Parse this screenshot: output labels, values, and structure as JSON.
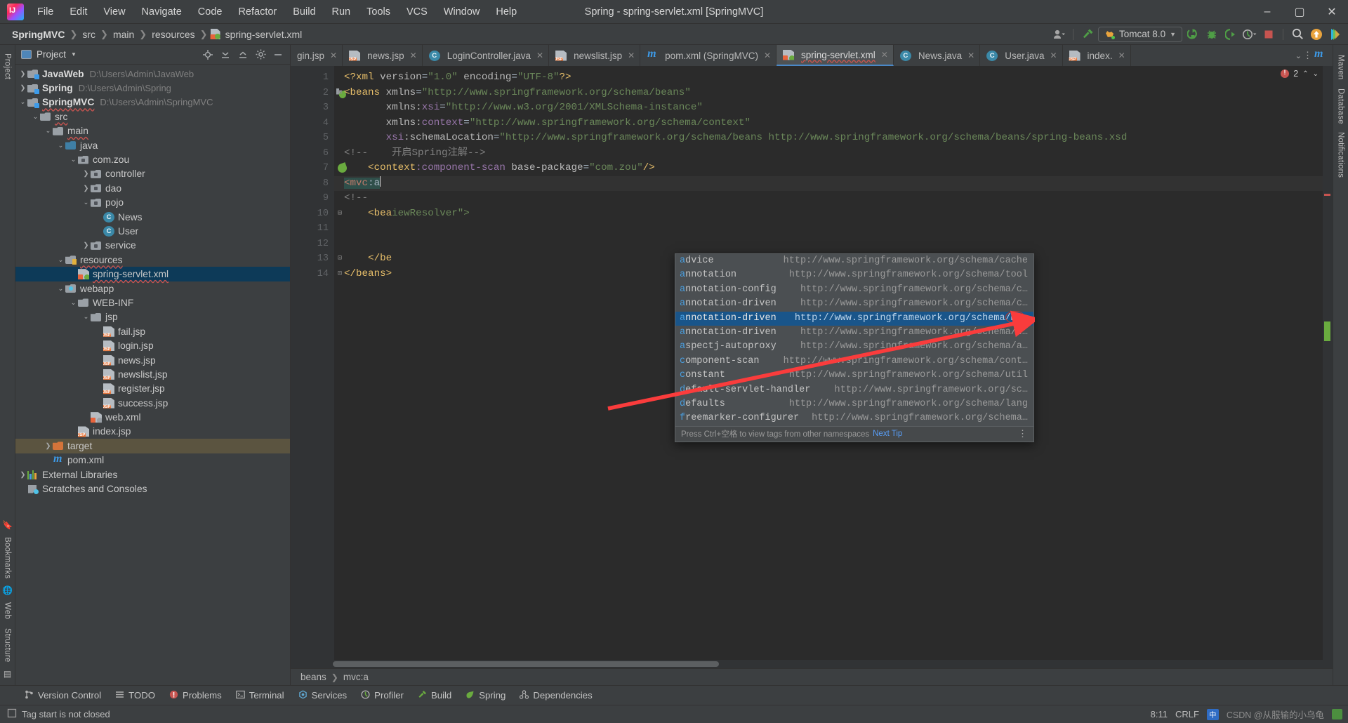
{
  "window": {
    "title": "Spring - spring-servlet.xml [SpringMVC]",
    "minimize": "–",
    "maximize": "▢",
    "close": "✕"
  },
  "menu": [
    "File",
    "Edit",
    "View",
    "Navigate",
    "Code",
    "Refactor",
    "Build",
    "Run",
    "Tools",
    "VCS",
    "Window",
    "Help"
  ],
  "breadcrumb": {
    "project": "SpringMVC",
    "items": [
      "src",
      "main",
      "resources"
    ],
    "file": "spring-servlet.xml"
  },
  "toolbar": {
    "run_config": "Tomcat 8.0",
    "icons": [
      "user-avatar-icon",
      "hammer-build-icon",
      "run-icon",
      "debug-icon",
      "run-with-coverage-icon",
      "profiler-icon",
      "stop-icon",
      "search-everywhere-icon",
      "update-project-icon",
      "idea-feature-icon"
    ]
  },
  "project_panel": {
    "title": "Project",
    "header_icons": [
      "locate-icon",
      "expand-all-icon",
      "collapse-all-icon",
      "settings-gear-icon",
      "hide-icon"
    ],
    "tree": [
      {
        "label": "JavaWeb",
        "path": "D:\\Users\\Admin\\JavaWeb",
        "indent": 0,
        "arrow": "collapsed",
        "icon": "module",
        "bold": true
      },
      {
        "label": "Spring",
        "path": "D:\\Users\\Admin\\Spring",
        "indent": 0,
        "arrow": "collapsed",
        "icon": "module",
        "bold": true
      },
      {
        "label": "SpringMVC",
        "path": "D:\\Users\\Admin\\SpringMVC",
        "indent": 0,
        "arrow": "expanded",
        "icon": "module",
        "bold": true,
        "wavy": true
      },
      {
        "label": "src",
        "path": "",
        "indent": 1,
        "arrow": "expanded",
        "icon": "folder",
        "wavy": true
      },
      {
        "label": "main",
        "path": "",
        "indent": 2,
        "arrow": "expanded",
        "icon": "folder",
        "wavy": true
      },
      {
        "label": "java",
        "path": "",
        "indent": 3,
        "arrow": "expanded",
        "icon": "sourceroot"
      },
      {
        "label": "com.zou",
        "path": "",
        "indent": 4,
        "arrow": "expanded",
        "icon": "package"
      },
      {
        "label": "controller",
        "path": "",
        "indent": 5,
        "arrow": "collapsed",
        "icon": "package"
      },
      {
        "label": "dao",
        "path": "",
        "indent": 5,
        "arrow": "collapsed",
        "icon": "package"
      },
      {
        "label": "pojo",
        "path": "",
        "indent": 5,
        "arrow": "expanded",
        "icon": "package"
      },
      {
        "label": "News",
        "path": "",
        "indent": 6,
        "arrow": "none",
        "icon": "class"
      },
      {
        "label": "User",
        "path": "",
        "indent": 6,
        "arrow": "none",
        "icon": "class"
      },
      {
        "label": "service",
        "path": "",
        "indent": 5,
        "arrow": "collapsed",
        "icon": "package"
      },
      {
        "label": "resources",
        "path": "",
        "indent": 3,
        "arrow": "expanded",
        "icon": "resources",
        "wavy": true
      },
      {
        "label": "spring-servlet.xml",
        "path": "",
        "indent": 4,
        "arrow": "none",
        "icon": "spring-xml",
        "selected": true,
        "wavy": true
      },
      {
        "label": "webapp",
        "path": "",
        "indent": 3,
        "arrow": "expanded",
        "icon": "webroot"
      },
      {
        "label": "WEB-INF",
        "path": "",
        "indent": 4,
        "arrow": "expanded",
        "icon": "folder"
      },
      {
        "label": "jsp",
        "path": "",
        "indent": 5,
        "arrow": "expanded",
        "icon": "folder"
      },
      {
        "label": "fail.jsp",
        "path": "",
        "indent": 6,
        "arrow": "none",
        "icon": "jsp"
      },
      {
        "label": "login.jsp",
        "path": "",
        "indent": 6,
        "arrow": "none",
        "icon": "jsp"
      },
      {
        "label": "news.jsp",
        "path": "",
        "indent": 6,
        "arrow": "none",
        "icon": "jsp"
      },
      {
        "label": "newslist.jsp",
        "path": "",
        "indent": 6,
        "arrow": "none",
        "icon": "jsp"
      },
      {
        "label": "register.jsp",
        "path": "",
        "indent": 6,
        "arrow": "none",
        "icon": "jsp"
      },
      {
        "label": "success.jsp",
        "path": "",
        "indent": 6,
        "arrow": "none",
        "icon": "jsp"
      },
      {
        "label": "web.xml",
        "path": "",
        "indent": 5,
        "arrow": "none",
        "icon": "web-xml"
      },
      {
        "label": "index.jsp",
        "path": "",
        "indent": 4,
        "arrow": "none",
        "icon": "jsp"
      },
      {
        "label": "target",
        "path": "",
        "indent": 2,
        "arrow": "collapsed",
        "icon": "target",
        "highlight": true
      },
      {
        "label": "pom.xml",
        "path": "",
        "indent": 2,
        "arrow": "none",
        "icon": "maven"
      },
      {
        "label": "External Libraries",
        "path": "",
        "indent": 0,
        "arrow": "collapsed",
        "icon": "library"
      },
      {
        "label": "Scratches and Consoles",
        "path": "",
        "indent": 0,
        "arrow": "none",
        "icon": "scratch"
      }
    ]
  },
  "left_rail": {
    "top": "Project",
    "bottom": [
      "Bookmarks",
      "Web",
      "Structure"
    ]
  },
  "right_rail": {
    "items": [
      "Maven",
      "Database",
      "Notifications"
    ]
  },
  "editor_tabs": [
    {
      "label": "gin.jsp",
      "icon": "jsp",
      "active": false,
      "clipped": true
    },
    {
      "label": "news.jsp",
      "icon": "jsp",
      "active": false
    },
    {
      "label": "LoginController.java",
      "icon": "class",
      "active": false
    },
    {
      "label": "newslist.jsp",
      "icon": "jsp",
      "active": false
    },
    {
      "label": "pom.xml (SpringMVC)",
      "icon": "maven",
      "active": false
    },
    {
      "label": "spring-servlet.xml",
      "icon": "spring-xml",
      "active": true,
      "error": true
    },
    {
      "label": "News.java",
      "icon": "class",
      "active": false
    },
    {
      "label": "User.java",
      "icon": "class",
      "active": false
    },
    {
      "label": "index.",
      "icon": "jsp",
      "active": false,
      "clipped": true
    }
  ],
  "editor": {
    "inspection_count": "2",
    "lines": [
      {
        "n": "1",
        "tokens": [
          {
            "t": "<?xml ",
            "c": "pi"
          },
          {
            "t": "version",
            "c": "attr"
          },
          {
            "t": "=",
            "c": "txt"
          },
          {
            "t": "\"1.0\"",
            "c": "str"
          },
          {
            "t": " encoding",
            "c": "attr"
          },
          {
            "t": "=",
            "c": "txt"
          },
          {
            "t": "\"UTF-8\"",
            "c": "str"
          },
          {
            "t": "?>",
            "c": "pi"
          }
        ]
      },
      {
        "n": "2",
        "tokens": [
          {
            "t": "<beans ",
            "c": "tag"
          },
          {
            "t": "xmlns",
            "c": "attr"
          },
          {
            "t": "=",
            "c": "txt"
          },
          {
            "t": "\"http://www.springframework.org/schema/beans\"",
            "c": "str"
          }
        ]
      },
      {
        "n": "3",
        "tokens": [
          {
            "t": "       xmlns:",
            "c": "attr"
          },
          {
            "t": "xsi",
            "c": "ns"
          },
          {
            "t": "=",
            "c": "txt"
          },
          {
            "t": "\"http://www.w3.org/2001/XMLSchema-instance\"",
            "c": "str"
          }
        ]
      },
      {
        "n": "4",
        "tokens": [
          {
            "t": "       xmlns:",
            "c": "attr"
          },
          {
            "t": "context",
            "c": "ns"
          },
          {
            "t": "=",
            "c": "txt"
          },
          {
            "t": "\"http://www.springframework.org/schema/context\"",
            "c": "str"
          }
        ]
      },
      {
        "n": "5",
        "tokens": [
          {
            "t": "       xsi",
            "c": "ns"
          },
          {
            "t": ":schemaLocation",
            "c": "attr"
          },
          {
            "t": "=",
            "c": "txt"
          },
          {
            "t": "\"http://www.springframework.org/schema/beans http://www.springframework.org/schema/beans/spring-beans.xsd",
            "c": "str"
          }
        ]
      },
      {
        "n": "6",
        "tokens": [
          {
            "t": "<!--    开启Spring注解-->",
            "c": "cmt"
          }
        ]
      },
      {
        "n": "7",
        "tokens": [
          {
            "t": "    <context",
            "c": "tag"
          },
          {
            "t": ":component-scan ",
            "c": "ns"
          },
          {
            "t": "base-package",
            "c": "attr"
          },
          {
            "t": "=",
            "c": "txt"
          },
          {
            "t": "\"com.zou\"",
            "c": "str"
          },
          {
            "t": "/>",
            "c": "tag"
          }
        ]
      },
      {
        "n": "8",
        "tokens": [
          {
            "t": "    <mvc:a",
            "c": "typing"
          }
        ]
      },
      {
        "n": "9",
        "tokens": [
          {
            "t": "<!--    ",
            "c": "cmt"
          }
        ]
      },
      {
        "n": "10",
        "tokens": [
          {
            "t": "    <bea",
            "c": "tag"
          },
          {
            "t": "iewResolver\">",
            "c": "str"
          }
        ]
      },
      {
        "n": "11",
        "tokens": []
      },
      {
        "n": "12",
        "tokens": []
      },
      {
        "n": "13",
        "tokens": [
          {
            "t": "    </be",
            "c": "tag"
          }
        ]
      },
      {
        "n": "14",
        "tokens": [
          {
            "t": "</beans>",
            "c": "tag"
          }
        ]
      }
    ],
    "typed_text": "<mvc:a",
    "breadcrumb": [
      "beans",
      "mvc:a"
    ]
  },
  "autocomplete": {
    "items": [
      {
        "name": "advice",
        "match": "a",
        "url": "http://www.springframework.org/schema/cache"
      },
      {
        "name": "annotation",
        "match": "a",
        "url": "http://www.springframework.org/schema/tool"
      },
      {
        "name": "annotation-config",
        "match": "a",
        "url": "http://www.springframework.org/schema/c…"
      },
      {
        "name": "annotation-driven",
        "match": "a",
        "url": "http://www.springframework.org/schema/c…"
      },
      {
        "name": "annotation-driven",
        "match": "a",
        "url": "http://www.springframework.org/schema/mvc",
        "selected": true
      },
      {
        "name": "annotation-driven",
        "match": "a",
        "url": "http://www.springframework.org/schema/t…"
      },
      {
        "name": "aspectj-autoproxy",
        "match": "a",
        "url": "http://www.springframework.org/schema/a…"
      },
      {
        "name": "component-scan",
        "match": "c",
        "url": "http://www.springframework.org/schema/cont…"
      },
      {
        "name": "constant",
        "match": "c",
        "url": "http://www.springframework.org/schema/util"
      },
      {
        "name": "default-servlet-handler",
        "match": "d",
        "url": "http://www.springframework.org/sc…"
      },
      {
        "name": "defaults",
        "match": "d",
        "url": "http://www.springframework.org/schema/lang"
      },
      {
        "name": "freemarker-configurer",
        "match": "f",
        "url": "http://www.springframework.org/schema/cache"
      }
    ],
    "footer_hint": "Press Ctrl+空格 to view tags from other namespaces",
    "footer_link": "Next Tip",
    "highlight_fragment": "mvc"
  },
  "tool_windows": [
    {
      "label": "Version Control",
      "icon": "branch-icon"
    },
    {
      "label": "TODO",
      "icon": "list-icon"
    },
    {
      "label": "Problems",
      "icon": "error-icon"
    },
    {
      "label": "Terminal",
      "icon": "terminal-icon"
    },
    {
      "label": "Services",
      "icon": "services-icon"
    },
    {
      "label": "Profiler",
      "icon": "profiler-icon"
    },
    {
      "label": "Build",
      "icon": "hammer-icon"
    },
    {
      "label": "Spring",
      "icon": "spring-leaf-icon"
    },
    {
      "label": "Dependencies",
      "icon": "dependencies-icon"
    }
  ],
  "status": {
    "message": "Tag start is not closed",
    "caret": "8:11",
    "line_sep": "CRLF",
    "watermark": "CSDN @从服输的小乌龟"
  },
  "colors": {
    "accent": "#4a88c7",
    "selection": "#19558a",
    "tree_selection": "#0d3a58",
    "error": "#c75450",
    "string": "#6a8759",
    "tag": "#e8bf6a",
    "annotation_arrow": "#fa3c3c"
  }
}
